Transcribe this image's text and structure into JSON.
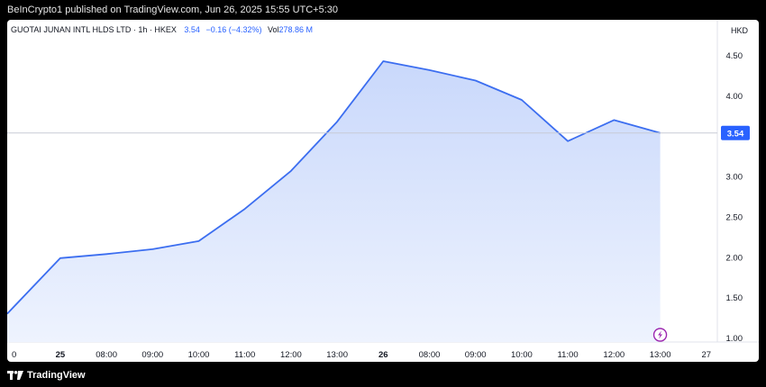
{
  "header": {
    "published": "BeInCrypto1 published on TradingView.com, Jun 26, 2025 15:55 UTC+5:30"
  },
  "legend": {
    "symbol": "GUOTAI JUNAN INTL HLDS LTD · 1h · HKEX",
    "price": "3.54",
    "change": "−0.16 (−4.32%)",
    "volume_label": "Vol",
    "volume_value": "278.86 M"
  },
  "currency": "HKD",
  "footer": {
    "brand": "TradingView"
  },
  "colors": {
    "line": "#3c6ef0",
    "fill_top": "#c9d8fb",
    "fill_bottom": "#eef3fe",
    "price_tag": "#2962ff",
    "event_icon": "#9c27b0"
  },
  "chart_data": {
    "type": "area",
    "title": "",
    "xlabel": "",
    "ylabel": "",
    "ylim": [
      0.95,
      4.72
    ],
    "y_ticks": [
      "1.00",
      "1.50",
      "2.00",
      "2.50",
      "3.00",
      "3.50",
      "4.00",
      "4.50"
    ],
    "y_tick_values": [
      1.0,
      1.5,
      2.0,
      2.5,
      3.0,
      3.5,
      4.0,
      4.5
    ],
    "x_tick_labels": [
      "0",
      "25",
      "08:00",
      "09:00",
      "10:00",
      "11:00",
      "12:00",
      "13:00",
      "26",
      "08:00",
      "09:00",
      "10:00",
      "11:00",
      "12:00",
      "13:00",
      "27"
    ],
    "x_tick_bold": [
      false,
      true,
      false,
      false,
      false,
      false,
      false,
      false,
      true,
      false,
      false,
      false,
      false,
      false,
      false,
      false
    ],
    "x_start": -0.15,
    "x_end": 15.2,
    "series": [
      {
        "x": [
          -0.15,
          1,
          2,
          3,
          4,
          5,
          6,
          7,
          8,
          9,
          10,
          11,
          12,
          13,
          14
        ],
        "values": [
          1.3,
          1.99,
          2.04,
          2.1,
          2.2,
          2.6,
          3.07,
          3.68,
          4.43,
          4.32,
          4.19,
          3.95,
          3.44,
          3.7,
          3.54
        ]
      }
    ],
    "last_price_label": "3.54",
    "last_price": 3.54
  }
}
